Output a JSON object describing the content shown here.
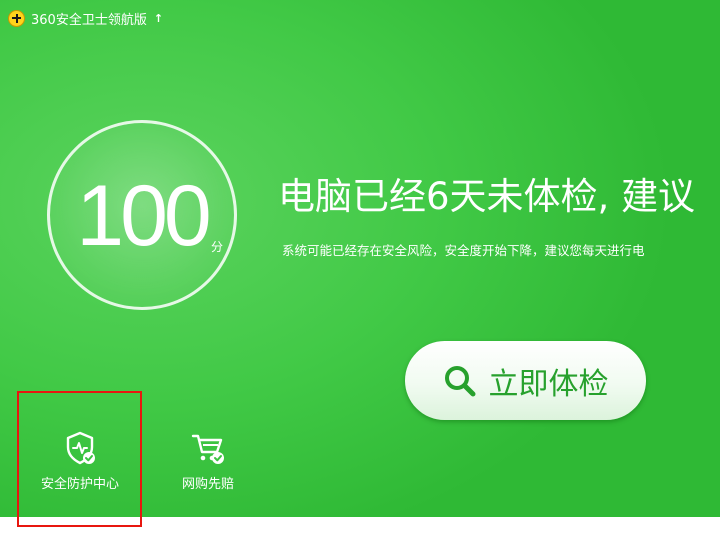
{
  "app": {
    "title": "360安全卫士领航版",
    "logo_icon": "plus-logo-icon",
    "update_icon": "up-arrow-icon",
    "update_glyph": "↑"
  },
  "score": {
    "value": "100",
    "unit": "分"
  },
  "status": {
    "headline": "电脑已经6天未体检, 建议",
    "subtext": "系统可能已经存在安全风险，安全度开始下降，建议您每天进行电"
  },
  "primary_action": {
    "label": "立即体检",
    "icon": "search-icon"
  },
  "nav": {
    "items": [
      {
        "label": "安全防护中心",
        "icon": "shield-check-icon"
      },
      {
        "label": "网购先赔",
        "icon": "cart-check-icon"
      }
    ]
  },
  "colors": {
    "background": "#41c946",
    "accent_green": "#27a12d",
    "highlight_red": "#e8160f",
    "logo_yellow": "#ffd31c"
  }
}
